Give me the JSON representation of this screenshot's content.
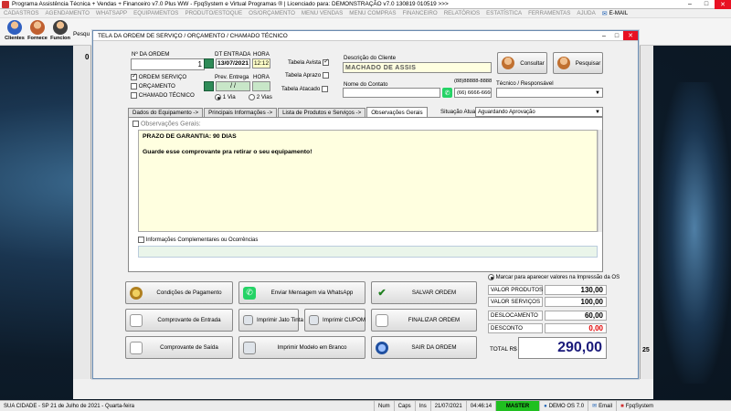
{
  "app": {
    "title": "Programa Assistência Técnica + Vendas + Financeiro v7.0 Plus WW - FpqSystem e Virtual Programas ® | Licenciado para: DEMONSTRAÇÃO v7.0 130819 010519 >>>",
    "menu": [
      "CADASTROS",
      "AGENDAMENTO",
      "WHATSAPP",
      "EQUIPAMENTOS",
      "PRODUTO/ESTOQUE",
      "OS/ORÇAMENTO",
      "MENU VENDAS",
      "MENU COMPRAS",
      "FINANCEIRO",
      "RELATÓRIOS",
      "ESTATÍSTICA",
      "FERRAMENTAS",
      "AJUDA"
    ],
    "menu_email": "E-MAIL",
    "toolbar": [
      "Clientes",
      "Fornece",
      "Funcion"
    ],
    "pesquisa_stub": "Pesqu",
    "left_stub": "0",
    "right_stub": "25",
    "colors": {
      "accent": "#e81123",
      "master": "#20c020"
    }
  },
  "dialog": {
    "title": "TELA DA ORDEM DE SERVIÇO / ORÇAMENTO / CHAMADO TÉCNICO",
    "ordem_label": "Nº DA ORDEM",
    "ordem_value": "1",
    "tipos": [
      {
        "label": "ORDEM SERVIÇO",
        "checked": true
      },
      {
        "label": "ORÇAMENTO",
        "checked": false
      },
      {
        "label": "CHAMADO TÉCNICO",
        "checked": false
      }
    ],
    "dt_entrada_label": "DT ENTRADA",
    "dt_entrada_value": "13/07/2021",
    "hora_label": "HORA",
    "hora_value": "12:12",
    "prev_entrega_label": "Prev. Entrega",
    "prev_entrega_value": "/ /",
    "hora2_label": "HORA",
    "vias": [
      {
        "label": "1 Via",
        "selected": true
      },
      {
        "label": "2 Vias",
        "selected": false
      }
    ],
    "tabelas": [
      {
        "label": "Tabela Avista",
        "checked": true
      },
      {
        "label": "Tabela Aprazo",
        "checked": false
      },
      {
        "label": "Tabela Atacado",
        "checked": false
      }
    ],
    "cliente_label": "Descrição do Cliente",
    "cliente_value": "MACHADO DE ASSIS",
    "contato_label": "Nome do Contato",
    "fone1": "(88)88888-8888",
    "fone2": "(66) 6666-6666",
    "consultar": "Consultar",
    "pesquisar": "Pesquisar",
    "tecnico_label": "Técnico / Responsável",
    "tabs": [
      "Dados do Equipamento ->",
      "Principais Informações ->",
      "Lista de Produtos e Serviços ->",
      "Observações Gerais"
    ],
    "situacao_label": "Situação Atual",
    "situacao_value": "Aguardando Aprovação",
    "obs_label": "Observações Gerais:",
    "obs_line1": "PRAZO DE GARANTIA: 90 DIAS",
    "obs_line2": "Guarde esse comprovante pra retirar o seu equipamento!",
    "info_label": "Informações Complementares ou Ocorrências",
    "buttons": {
      "condicoes": "Condições de Pagamento",
      "whatsapp": "Enviar Mensagem via WhatsApp",
      "salvar": "SALVAR ORDEM",
      "entrada": "Comprovante de Entrada",
      "jato": "Imprimir Jato Tinta",
      "cupom": "Imprimir CUPOM",
      "finalizar": "FINALIZAR ORDEM",
      "saida": "Comprovante de Saída",
      "modelo": "Imprimir Modelo em Branco",
      "sair": "SAIR DA ORDEM"
    },
    "marcar_label": "Marcar para aparecer valores na Impressão da OS",
    "totais": [
      {
        "label": "VALOR PRODUTOS",
        "value": "130,00",
        "color": "#000000"
      },
      {
        "label": "VALOR SERVIÇOS",
        "value": "100,00",
        "color": "#000000"
      },
      {
        "label": "DESLOCAMENTO",
        "value": "60,00",
        "color": "#000000"
      },
      {
        "label": "DESCONTO",
        "value": "0,00",
        "color": "#e00000"
      }
    ],
    "total_label": "TOTAL R$",
    "total_value": "290,00"
  },
  "status": {
    "cidade": "SUA CIDADE - SP 21 de Julho de 2021 - Quarta-feira",
    "num": "Num",
    "caps": "Caps",
    "ins": "Ins",
    "data": "21/07/2021",
    "hora": "04:46:14",
    "master": "MASTER",
    "demo": "DEMO OS 7.0",
    "email": "Email",
    "brand": "FpqSystem"
  }
}
